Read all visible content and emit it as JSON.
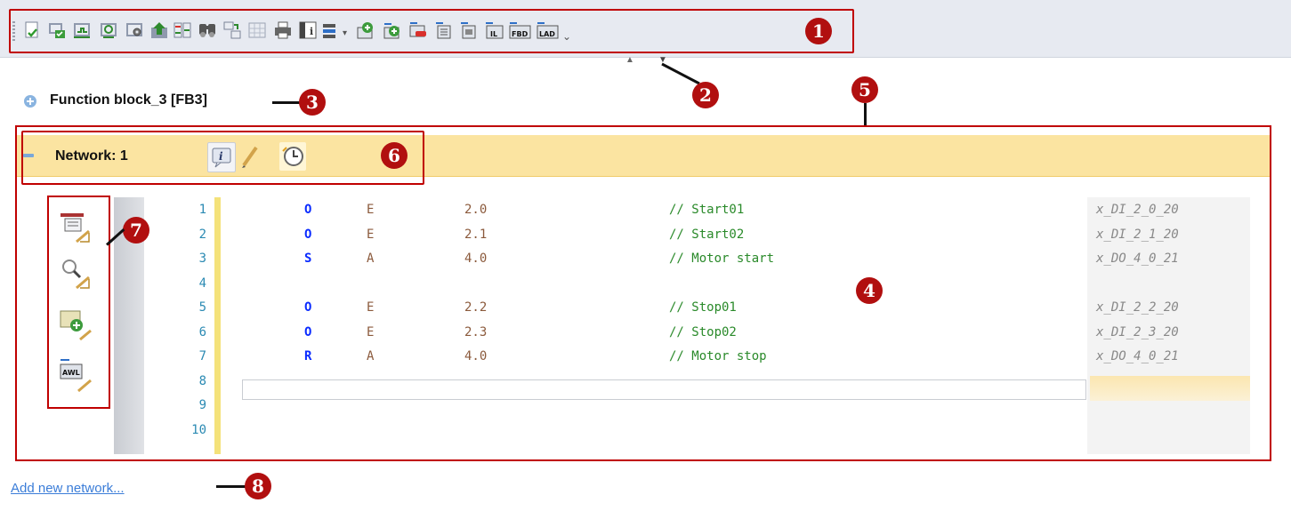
{
  "toolbar": {
    "buttons": [
      "new-document-icon",
      "compile-icon",
      "download-icon",
      "monitor-icon",
      "settings-icon",
      "upload-icon",
      "compare-icon",
      "find-icon",
      "replace-icon",
      "grid-icon",
      "print-icon",
      "info-icon",
      "display-options-icon",
      "insert-network-icon",
      "add-network-icon",
      "delete-network-icon",
      "network-up-icon",
      "network-down-icon",
      "il-icon",
      "fbd-icon",
      "lad-icon"
    ],
    "il_label": "IL",
    "fbd_label": "FBD",
    "lad_label": "LAD",
    "more_label": "⌄"
  },
  "callouts": [
    "1",
    "2",
    "3",
    "4",
    "5",
    "6",
    "7",
    "8"
  ],
  "block": {
    "title": "Function block_3 [FB3]"
  },
  "network": {
    "label": "Network: 1"
  },
  "code": {
    "lines": [
      {
        "no": "1",
        "op": "O",
        "operand": "E",
        "address": "2.0",
        "comment": "// Start01",
        "symbol": "x_DI_2_0_20"
      },
      {
        "no": "2",
        "op": "O",
        "operand": "E",
        "address": "2.1",
        "comment": "// Start02",
        "symbol": "x_DI_2_1_20"
      },
      {
        "no": "3",
        "op": "S",
        "operand": "A",
        "address": "4.0",
        "comment": "// Motor start",
        "symbol": "x_DO_4_0_21"
      },
      {
        "no": "4",
        "op": "",
        "operand": "",
        "address": "",
        "comment": "",
        "symbol": ""
      },
      {
        "no": "5",
        "op": "O",
        "operand": "E",
        "address": "2.2",
        "comment": "// Stop01",
        "symbol": "x_DI_2_2_20"
      },
      {
        "no": "6",
        "op": "O",
        "operand": "E",
        "address": "2.3",
        "comment": "// Stop02",
        "symbol": "x_DI_2_3_20"
      },
      {
        "no": "7",
        "op": "R",
        "operand": "A",
        "address": "4.0",
        "comment": "// Motor stop",
        "symbol": "x_DO_4_0_21"
      },
      {
        "no": "8",
        "op": "",
        "operand": "",
        "address": "",
        "comment": "",
        "symbol": ""
      },
      {
        "no": "9",
        "op": "",
        "operand": "",
        "address": "",
        "comment": "",
        "symbol": ""
      },
      {
        "no": "10",
        "op": "",
        "operand": "",
        "address": "",
        "comment": "",
        "symbol": ""
      }
    ]
  },
  "side_tools": {
    "awl_label": "AWL"
  },
  "footer": {
    "add_network": "Add new network..."
  },
  "colors": {
    "callout": "#b10f0f",
    "frame": "#c00000",
    "network_header": "#fbe4a1"
  }
}
